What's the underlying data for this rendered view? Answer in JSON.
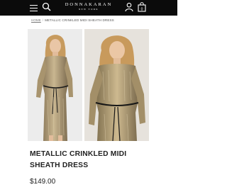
{
  "header": {
    "brand_name": "DONNAKARAN",
    "brand_sub": "NEW YORK",
    "icons": [
      "menu-icon",
      "search-icon",
      "user-icon",
      "shopping-bag-icon"
    ],
    "bag_count": "0"
  },
  "breadcrumb": {
    "home": "HOME",
    "separator": "/",
    "current": "METALLIC CRINKLED MIDI SHEATH DRESS"
  },
  "product": {
    "title": "METALLIC CRINKLED MIDI SHEATH DRESS",
    "price": "$149.00",
    "images": [
      "product-image-front",
      "product-image-detail"
    ]
  },
  "colors": {
    "header_bg": "#0b0b0b",
    "text": "#222222",
    "dress_gold": "#b8a27a"
  }
}
